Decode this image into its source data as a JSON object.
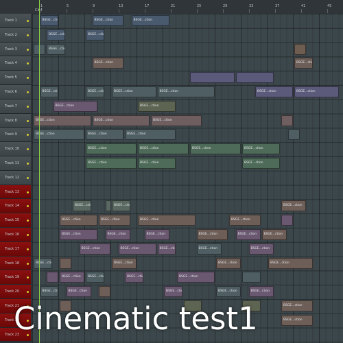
{
  "ruler": {
    "marks": [
      "1",
      "5",
      "9",
      "13",
      "17",
      "21",
      "25",
      "29",
      "33",
      "37",
      "41",
      "45"
    ],
    "selection_label": "C#4"
  },
  "tracks": [
    {
      "label": "Track 1",
      "color": "normal"
    },
    {
      "label": "Track 2",
      "color": "normal"
    },
    {
      "label": "Track 3",
      "color": "normal"
    },
    {
      "label": "Track 4",
      "color": "normal"
    },
    {
      "label": "Track 5",
      "color": "normal"
    },
    {
      "label": "Track 6",
      "color": "normal"
    },
    {
      "label": "Track 7",
      "color": "normal"
    },
    {
      "label": "Track 8",
      "color": "normal"
    },
    {
      "label": "Track 9",
      "color": "normal"
    },
    {
      "label": "Track 10",
      "color": "normal"
    },
    {
      "label": "Track 11",
      "color": "normal"
    },
    {
      "label": "Track 12",
      "color": "normal"
    },
    {
      "label": "Track 13",
      "color": "red"
    },
    {
      "label": "Track 14",
      "color": "red"
    },
    {
      "label": "Track 15",
      "color": "red"
    },
    {
      "label": "Track 16",
      "color": "red"
    },
    {
      "label": "Track 17",
      "color": "red"
    },
    {
      "label": "Track 18",
      "color": "red"
    },
    {
      "label": "Track 19",
      "color": "red"
    },
    {
      "label": "Track 20",
      "color": "red"
    },
    {
      "label": "Track 21",
      "color": "red"
    },
    {
      "label": "Track 22",
      "color": "red"
    },
    {
      "label": "Track 23",
      "color": "red"
    }
  ],
  "clips": [
    {
      "track": 0,
      "start": 1,
      "len": 3,
      "label": "BSGE...ction",
      "color": "#4a5a6e"
    },
    {
      "track": 0,
      "start": 9,
      "len": 5,
      "label": "BSGE...ction",
      "color": "#4a5a6e"
    },
    {
      "track": 0,
      "start": 15,
      "len": 6,
      "label": "BSGE...ction",
      "color": "#4a5a6e"
    },
    {
      "track": 1,
      "start": 2,
      "len": 3,
      "label": "BSGE...ction",
      "color": "#4a5a6e"
    },
    {
      "track": 1,
      "start": 8,
      "len": 3,
      "label": "BSGE...ction",
      "color": "#4a5a6e"
    },
    {
      "track": 2,
      "start": 0,
      "len": 2,
      "label": "",
      "color": "#4f5e63"
    },
    {
      "track": 2,
      "start": 2,
      "len": 3,
      "label": "BSGE...ction",
      "color": "#4f5e63"
    },
    {
      "track": 2,
      "start": 40,
      "len": 2,
      "label": "",
      "color": "#6e5e52"
    },
    {
      "track": 3,
      "start": 9,
      "len": 5,
      "label": "BSGE...ction",
      "color": "#6e5e58"
    },
    {
      "track": 3,
      "start": 40,
      "len": 3,
      "label": "BSGE...ction",
      "color": "#6e5e58"
    },
    {
      "track": 4,
      "start": 24,
      "len": 7,
      "label": "",
      "color": "#5c5a7a"
    },
    {
      "track": 4,
      "start": 31,
      "len": 6,
      "label": "",
      "color": "#5c5a7a"
    },
    {
      "track": 5,
      "start": 1,
      "len": 3,
      "label": "BSGE...ction",
      "color": "#4f5e63"
    },
    {
      "track": 5,
      "start": 8,
      "len": 3,
      "label": "BSGE...ction",
      "color": "#4f5e63"
    },
    {
      "track": 5,
      "start": 12,
      "len": 7,
      "label": "BSGE...ction",
      "color": "#4f5e63"
    },
    {
      "track": 5,
      "start": 19,
      "len": 9,
      "label": "BSGE...ction",
      "color": "#4f5e63"
    },
    {
      "track": 5,
      "start": 34,
      "len": 6,
      "label": "BSGE...ction",
      "color": "#5c5a7a"
    },
    {
      "track": 5,
      "start": 40,
      "len": 7,
      "label": "BSGE...ction",
      "color": "#5c5a7a"
    },
    {
      "track": 6,
      "start": 3,
      "len": 7,
      "label": "BSGE...ction",
      "color": "#6a5870"
    },
    {
      "track": 6,
      "start": 16,
      "len": 6,
      "label": "BSGE...ction",
      "color": "#5e6452"
    },
    {
      "track": 7,
      "start": 0,
      "len": 9,
      "label": "BSGE...ction",
      "color": "#6e5e60"
    },
    {
      "track": 7,
      "start": 9,
      "len": 9,
      "label": "BSGE...ction",
      "color": "#6e5e60"
    },
    {
      "track": 7,
      "start": 18,
      "len": 8,
      "label": "BSGE...ction",
      "color": "#6e5e60"
    },
    {
      "track": 7,
      "start": 38,
      "len": 2,
      "label": "",
      "color": "#6e5e60"
    },
    {
      "track": 8,
      "start": 0,
      "len": 8,
      "label": "BSGE...ction",
      "color": "#4f5e63"
    },
    {
      "track": 8,
      "start": 8,
      "len": 6,
      "label": "BSGE...ction",
      "color": "#4f5e63"
    },
    {
      "track": 8,
      "start": 14,
      "len": 8,
      "label": "BSGE...ction",
      "color": "#4f5e63"
    },
    {
      "track": 8,
      "start": 39,
      "len": 2,
      "label": "",
      "color": "#4f5e63"
    },
    {
      "track": 9,
      "start": 8,
      "len": 8,
      "label": "BSGE...ction",
      "color": "#4e6a58"
    },
    {
      "track": 9,
      "start": 16,
      "len": 8,
      "label": "BSGE...ction",
      "color": "#4e6a58"
    },
    {
      "track": 9,
      "start": 24,
      "len": 8,
      "label": "BSGE...ction",
      "color": "#4e6a58"
    },
    {
      "track": 9,
      "start": 32,
      "len": 6,
      "label": "BSGE...ction",
      "color": "#4e6a58"
    },
    {
      "track": 10,
      "start": 8,
      "len": 8,
      "label": "BSGE...ction",
      "color": "#4e6a58"
    },
    {
      "track": 10,
      "start": 16,
      "len": 6,
      "label": "BSGE...ction",
      "color": "#4e6a58"
    },
    {
      "track": 10,
      "start": 32,
      "len": 6,
      "label": "BSGE...ction",
      "color": "#4e6a58"
    },
    {
      "track": 13,
      "start": 6,
      "len": 3,
      "label": "BSGE...ction",
      "color": "#5a6862"
    },
    {
      "track": 13,
      "start": 11,
      "len": 1,
      "label": "",
      "color": "#5a6862"
    },
    {
      "track": 13,
      "start": 12,
      "len": 3,
      "label": "BSGE...ction",
      "color": "#5a6862"
    },
    {
      "track": 13,
      "start": 38,
      "len": 4,
      "label": "BSGE...ction",
      "color": "#6e5e58"
    },
    {
      "track": 14,
      "start": 4,
      "len": 6,
      "label": "BSGE...ction",
      "color": "#6e5e58"
    },
    {
      "track": 14,
      "start": 10,
      "len": 5,
      "label": "BSGE...ction",
      "color": "#6e5e58"
    },
    {
      "track": 14,
      "start": 16,
      "len": 9,
      "label": "BSGE...ction",
      "color": "#6e5e58"
    },
    {
      "track": 14,
      "start": 30,
      "len": 5,
      "label": "BSGE...ction",
      "color": "#6e5e58"
    },
    {
      "track": 14,
      "start": 38,
      "len": 2,
      "label": "",
      "color": "#6a5870"
    },
    {
      "track": 15,
      "start": 4,
      "len": 6,
      "label": "BSGE...ction",
      "color": "#6a5870"
    },
    {
      "track": 15,
      "start": 11,
      "len": 4,
      "label": "BSGE...ction",
      "color": "#6a5870"
    },
    {
      "track": 15,
      "start": 17,
      "len": 4,
      "label": "BSGE...ction",
      "color": "#6a5870"
    },
    {
      "track": 15,
      "start": 25,
      "len": 5,
      "label": "BSGE...ction",
      "color": "#6e5e58"
    },
    {
      "track": 15,
      "start": 31,
      "len": 4,
      "label": "BSGE...ction",
      "color": "#6a5870"
    },
    {
      "track": 15,
      "start": 35,
      "len": 4,
      "label": "BSGE...ction",
      "color": "#6e5e58"
    },
    {
      "track": 16,
      "start": 7,
      "len": 5,
      "label": "BSGE...ction",
      "color": "#6a5870"
    },
    {
      "track": 16,
      "start": 13,
      "len": 6,
      "label": "BSGE...ction",
      "color": "#6a5870"
    },
    {
      "track": 16,
      "start": 19,
      "len": 3,
      "label": "BSGE...ction",
      "color": "#6a5870"
    },
    {
      "track": 16,
      "start": 25,
      "len": 4,
      "label": "BSGE...ction",
      "color": "#4f5e63"
    },
    {
      "track": 16,
      "start": 33,
      "len": 4,
      "label": "BSGE...ction",
      "color": "#6a5870"
    },
    {
      "track": 17,
      "start": 0,
      "len": 3,
      "label": "BSGE...ction",
      "color": "#4f5e63"
    },
    {
      "track": 17,
      "start": 4,
      "len": 2,
      "label": "",
      "color": "#6e5e58"
    },
    {
      "track": 17,
      "start": 12,
      "len": 4,
      "label": "BSGE...ction",
      "color": "#6e5e58"
    },
    {
      "track": 17,
      "start": 28,
      "len": 4,
      "label": "BSGE...ction",
      "color": "#6e5e58"
    },
    {
      "track": 17,
      "start": 36,
      "len": 7,
      "label": "BSGE...ction",
      "color": "#6e5e58"
    },
    {
      "track": 18,
      "start": 2,
      "len": 2,
      "label": "",
      "color": "#6a5870"
    },
    {
      "track": 18,
      "start": 4,
      "len": 4,
      "label": "BSGE...ction",
      "color": "#6a5870"
    },
    {
      "track": 18,
      "start": 8,
      "len": 3,
      "label": "BSGE...ction",
      "color": "#4f5e63"
    },
    {
      "track": 18,
      "start": 14,
      "len": 3,
      "label": "BSGE...ction",
      "color": "#6a5870"
    },
    {
      "track": 18,
      "start": 22,
      "len": 6,
      "label": "BSGE...ction",
      "color": "#6a5870"
    },
    {
      "track": 18,
      "start": 32,
      "len": 3,
      "label": "",
      "color": "#4f5e63"
    },
    {
      "track": 19,
      "start": 1,
      "len": 3,
      "label": "BSGE...ction",
      "color": "#4f5e63"
    },
    {
      "track": 19,
      "start": 5,
      "len": 4,
      "label": "BSGE...ction",
      "color": "#6a5870"
    },
    {
      "track": 19,
      "start": 10,
      "len": 2,
      "label": "",
      "color": "#6e5e58"
    },
    {
      "track": 19,
      "start": 20,
      "len": 3,
      "label": "BSGE...ction",
      "color": "#6a5870"
    },
    {
      "track": 19,
      "start": 28,
      "len": 4,
      "label": "BSGE...ction",
      "color": "#4f5e63"
    },
    {
      "track": 19,
      "start": 33,
      "len": 4,
      "label": "BSGE...ction",
      "color": "#6a5870"
    },
    {
      "track": 20,
      "start": 4,
      "len": 2,
      "label": "",
      "color": "#6e5e58"
    },
    {
      "track": 20,
      "start": 23,
      "len": 3,
      "label": "",
      "color": "#5e6452"
    },
    {
      "track": 20,
      "start": 32,
      "len": 3,
      "label": "",
      "color": "#5e6452"
    },
    {
      "track": 20,
      "start": 38,
      "len": 5,
      "label": "BSGE...ction",
      "color": "#6e5e58"
    },
    {
      "track": 21,
      "start": 38,
      "len": 5,
      "label": "BSGE...ction",
      "color": "#6e5e58"
    }
  ],
  "overlay": {
    "caption": "Cinematic test1"
  },
  "colors": {
    "background": "#3a4448",
    "header_red": "#8c1010",
    "playhead": "#8cd040"
  }
}
